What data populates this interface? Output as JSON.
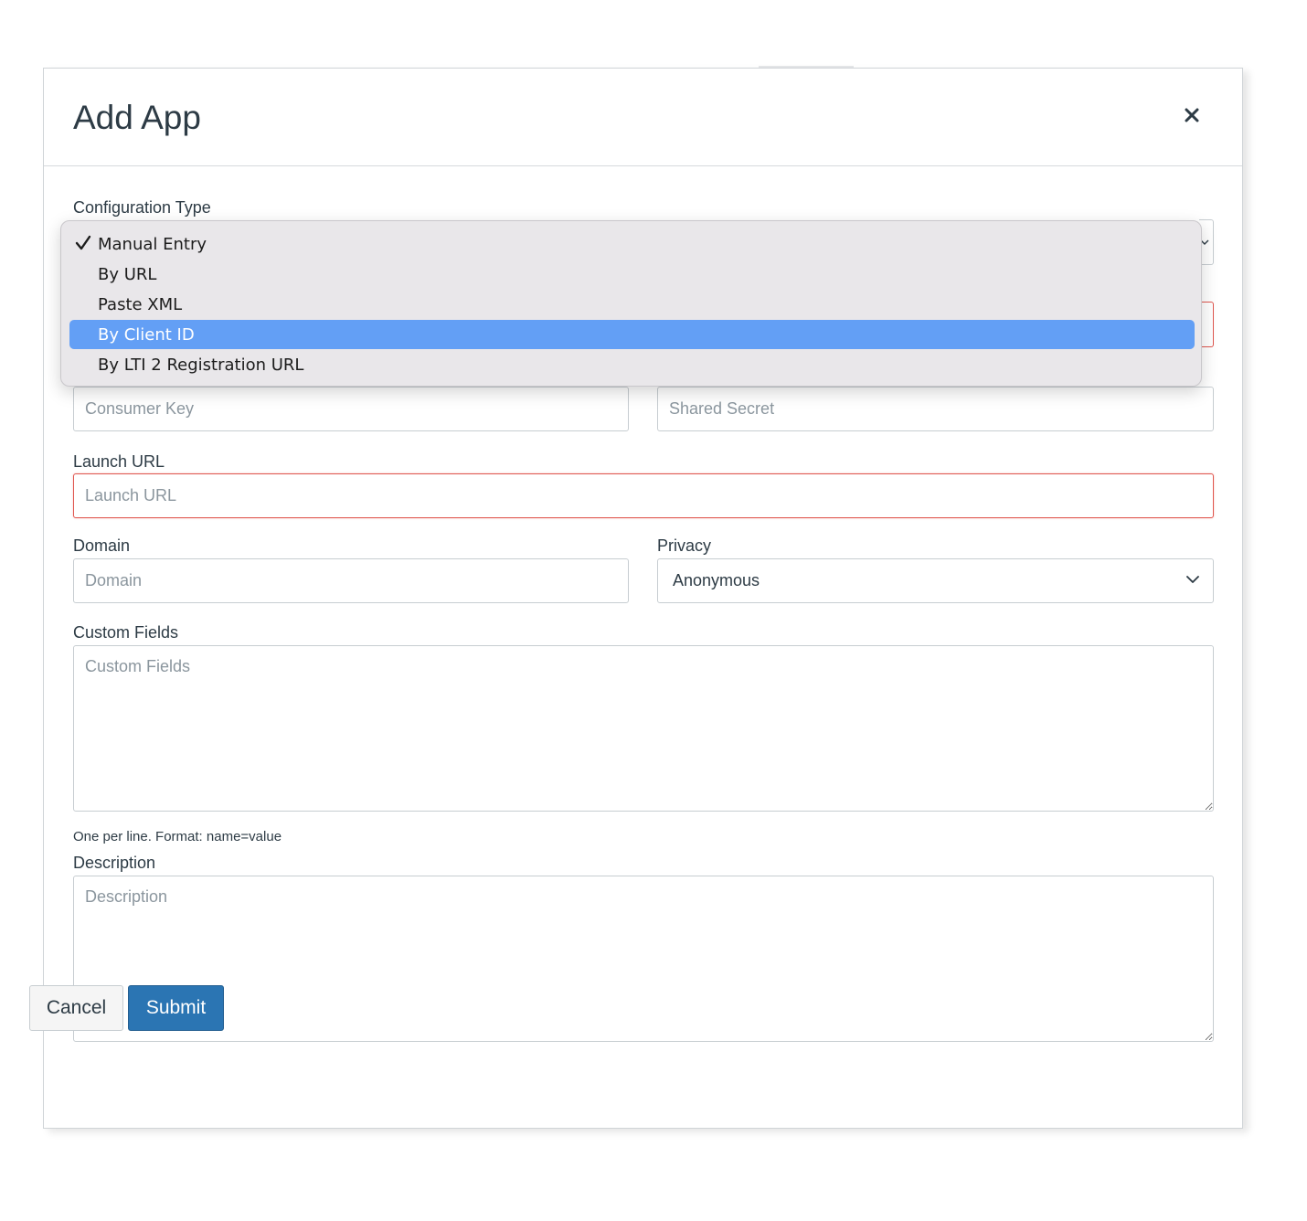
{
  "modal": {
    "title": "Add App",
    "close_icon": "close-icon"
  },
  "form": {
    "configuration_type": {
      "label": "Configuration Type",
      "selected": "Manual Entry",
      "options": [
        {
          "label": "Manual Entry",
          "checked": true,
          "highlighted": false
        },
        {
          "label": "By URL",
          "checked": false,
          "highlighted": false
        },
        {
          "label": "Paste XML",
          "checked": false,
          "highlighted": false
        },
        {
          "label": "By Client ID",
          "checked": false,
          "highlighted": true
        },
        {
          "label": "By LTI 2 Registration URL",
          "checked": false,
          "highlighted": false
        }
      ]
    },
    "consumer_key": {
      "placeholder": "Consumer Key",
      "value": ""
    },
    "shared_secret": {
      "placeholder": "Shared Secret",
      "value": ""
    },
    "launch_url": {
      "label": "Launch URL",
      "placeholder": "Launch URL",
      "value": ""
    },
    "domain": {
      "label": "Domain",
      "placeholder": "Domain",
      "value": ""
    },
    "privacy": {
      "label": "Privacy",
      "selected": "Anonymous"
    },
    "custom_fields": {
      "label": "Custom Fields",
      "placeholder": "Custom Fields",
      "hint": "One per line. Format: name=value"
    },
    "description": {
      "label": "Description",
      "placeholder": "Description"
    }
  },
  "buttons": {
    "cancel": "Cancel",
    "submit": "Submit"
  },
  "colors": {
    "submit_bg": "#2b75b3",
    "highlight": "#639ff5",
    "error_border": "#e0574f"
  }
}
